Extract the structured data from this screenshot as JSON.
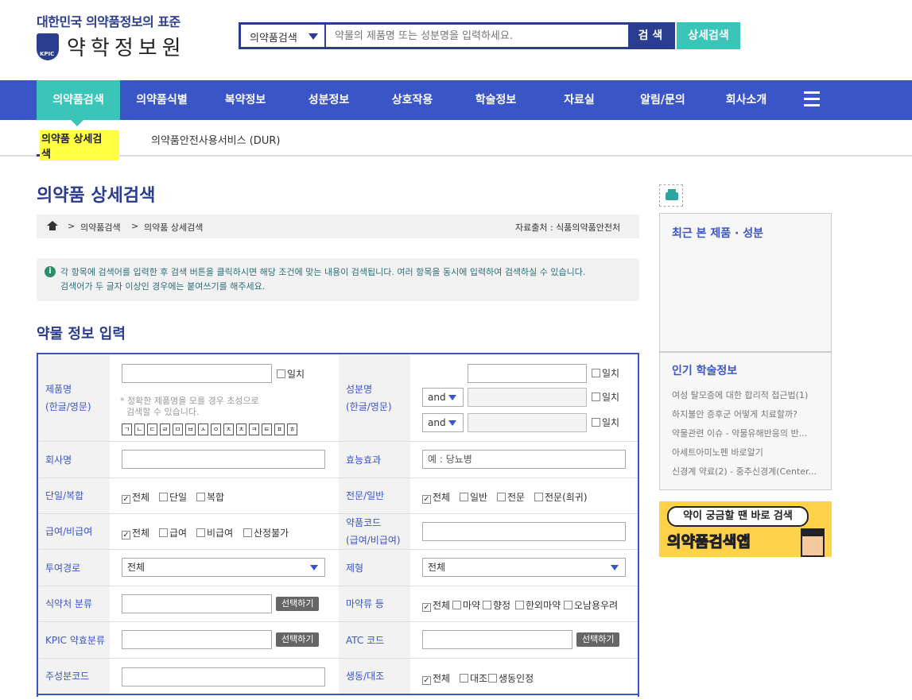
{
  "header": {
    "tagline": "대한민국 의약품정보의 표준",
    "logo_text": "약학정보원",
    "logo_badge": "KPIC",
    "search_category": "의약품검색",
    "search_placeholder": "약물의 제품명 또는 성분명을 입력하세요.",
    "search_button": "검 색",
    "advanced_button": "상세검색"
  },
  "nav": {
    "items": [
      "의약품검색",
      "의약품식별",
      "복약정보",
      "성분정보",
      "상호작용",
      "학술정보",
      "자료실",
      "알림/문의",
      "회사소개"
    ],
    "menu_icon": "hamburger-icon"
  },
  "subnav": {
    "items": [
      "의약품 상세검색",
      "의약품안전사용서비스 (DUR)"
    ]
  },
  "page": {
    "title": "의약품 상세검색",
    "breadcrumb": [
      "의약품검색",
      "의약품 상세검색"
    ],
    "breadcrumb_sep": ">",
    "source": "자료출처 : 식품의약품안전처",
    "notice_line1": "각 항목에 검색어를 입력한 후 검색 버튼을 클릭하시면 해당 조건에 맞는 내용이 검색됩니다. 여러 항목을 동시에 입력하여 검색하실 수 있습니다.",
    "notice_line2": "검색어가 두 글자 이상인 경우에는 붙여쓰기를 해주세요.",
    "section_title": "약물 정보 입력"
  },
  "form": {
    "product_name_label": [
      "제품명",
      "(한글/영문)"
    ],
    "exact_label": "일치",
    "product_hint": [
      "* 정확한 제품명을 모를 경우 초성으로",
      "검색할 수 있습니다."
    ],
    "chosung": [
      "ㄱ",
      "ㄴ",
      "ㄷ",
      "ㄹ",
      "ㅁ",
      "ㅂ",
      "ㅅ",
      "ㅇ",
      "ㅈ",
      "ㅊ",
      "ㅋ",
      "ㅌ",
      "ㅍ",
      "ㅎ"
    ],
    "ingredient_label": [
      "성분명",
      "(한글/영문)"
    ],
    "and_label": "and",
    "company_label": "회사명",
    "efficacy_label": "효능효과",
    "efficacy_placeholder": "예 : 당뇨병",
    "single_combo_label": "단일/복합",
    "single_combo_opts": [
      "전체",
      "단일",
      "복합"
    ],
    "rx_otc_label": "전문/일반",
    "rx_otc_opts": [
      "전체",
      "일반",
      "전문",
      "전문(희귀)"
    ],
    "coverage_label": "급여/비급여",
    "coverage_opts": [
      "전체",
      "급여",
      "비급여",
      "산정불가"
    ],
    "drug_code_label": [
      "약품코드",
      "(급여/비급여)"
    ],
    "route_label": "투여경로",
    "route_value": "전체",
    "form_type_label": "제형",
    "form_type_value": "전체",
    "mfds_label": "식약처 분류",
    "select_button": "선택하기",
    "narcotic_label": "마약류 등",
    "narcotic_opts": [
      "전체",
      "마약",
      "향정",
      "한외마약",
      "오남용우려"
    ],
    "kpic_label": "KPIC 약효분류",
    "atc_label": "ATC 코드",
    "ingredient_code_label": "주성분코드",
    "bioequiv_label": "생동/대조",
    "bioequiv_opts": [
      "전체",
      "대조",
      "생동인정"
    ]
  },
  "sidebar": {
    "recent_title": "최근 본 제품 · 성분",
    "popular_title": "인기 학술정보",
    "popular_items": [
      "여성 탈모증에 대한 합리적 접근법(1)",
      "하지불안 증후군 어떻게 치료할까?",
      "약물관련 이슈 - 약물유해반응의 반...",
      "아세트아미노펜 바로알기",
      "신경계 약료(2) - 중추신경계(Center..."
    ],
    "banner_text": "약이 궁금할 땐 바로 검색",
    "banner_app": "의약품검색",
    "banner_app_suffix": "앱"
  }
}
